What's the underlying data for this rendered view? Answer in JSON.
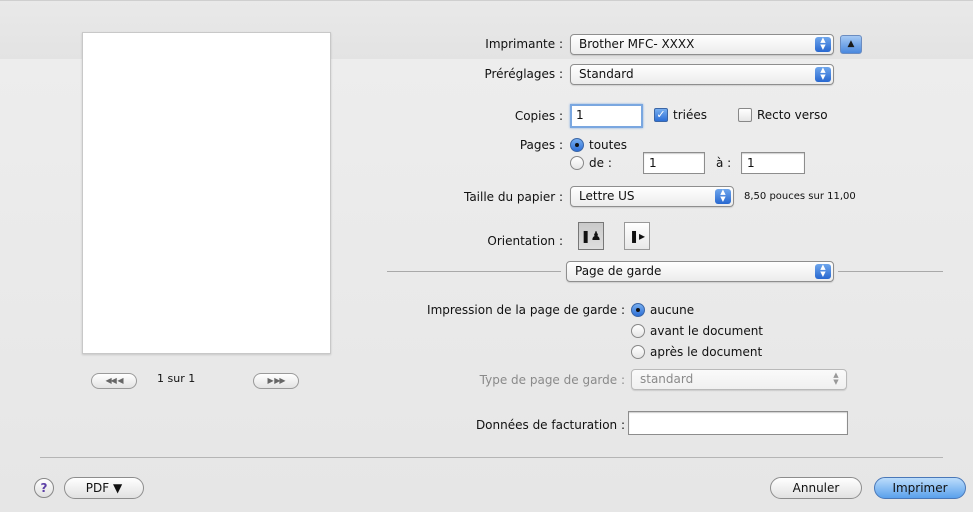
{
  "printer": {
    "label": "Imprimante :",
    "value": "Brother MFC- XXXX"
  },
  "presets": {
    "label": "Préréglages :",
    "value": "Standard"
  },
  "copies": {
    "label": "Copies :",
    "value": "1",
    "collated_label": "triées",
    "duplex_label": "Recto verso",
    "collated": true,
    "duplex": false
  },
  "pages": {
    "label": "Pages :",
    "all_label": "toutes",
    "from_label": "de :",
    "to_label": "à :",
    "from_value": "1",
    "to_value": "1",
    "selected": "all"
  },
  "paper": {
    "label": "Taille du papier :",
    "value": "Lettre US",
    "size_note": "8,50 pouces sur 11,00"
  },
  "orientation": {
    "label": "Orientation :",
    "selected": "portrait"
  },
  "section": {
    "value": "Page de garde"
  },
  "cover": {
    "label": "Impression de la page de garde :",
    "options": [
      "aucune",
      "avant le document",
      "après le document"
    ],
    "selected": "aucune",
    "type_label": "Type de page de garde :",
    "type_value": "standard"
  },
  "billing": {
    "label": "Données de facturation :",
    "value": ""
  },
  "preview_nav": {
    "page_text": "1 sur 1",
    "first_prev": "◀◀  ◀",
    "next_last": "▶  ▶▶"
  },
  "footer": {
    "help": "?",
    "pdf": "PDF ▼",
    "cancel": "Annuler",
    "print": "Imprimer"
  },
  "colors": {
    "accent": "#2d6fd6",
    "default_button": "#5aa0ec"
  }
}
